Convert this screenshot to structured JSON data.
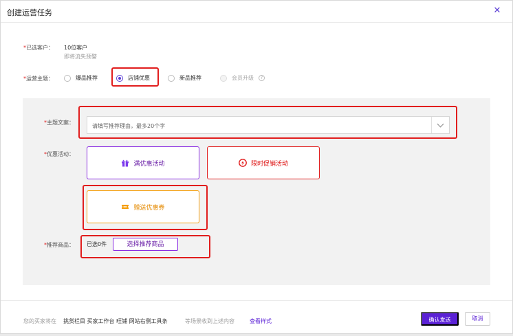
{
  "dialog": {
    "title": "创建运营任务",
    "close_glyph": "✕"
  },
  "customers": {
    "label": "已选客户：",
    "value": "10位客户",
    "subtext": "即将流失预警"
  },
  "theme": {
    "label": "运营主题：",
    "options": [
      {
        "label": "爆品推荐",
        "checked": false,
        "disabled": false
      },
      {
        "label": "店铺优惠",
        "checked": true,
        "disabled": false
      },
      {
        "label": "新品推荐",
        "checked": false,
        "disabled": false
      },
      {
        "label": "会员升级",
        "checked": false,
        "disabled": true
      }
    ],
    "help_glyph": "?"
  },
  "copy": {
    "label": "主题文案：",
    "placeholder": "请填写推荐理由，最多20个字"
  },
  "promo": {
    "label": "优惠活动：",
    "cards": [
      {
        "label": "满优惠活动",
        "icon": "gift-icon",
        "color": "#8a2be2"
      },
      {
        "label": "限时促销活动",
        "icon": "lightning-icon",
        "color": "#e11d1d"
      },
      {
        "label": "赠送优惠券",
        "icon": "coupon-icon",
        "color": "#f59e0b"
      }
    ]
  },
  "products": {
    "label": "推荐商品：",
    "selected_count": "已选0件",
    "select_button": "选择推荐商品"
  },
  "footer": {
    "prefix": "您的买家将在",
    "channels": "挑货栏目 买家工作台 旺铺 网站右侧工具条",
    "suffix": "等场景收到上述内容",
    "preview_link": "查看样式",
    "confirm_button": "确认发送",
    "cancel_button": "取消"
  },
  "colors": {
    "accent": "#5b21d6",
    "highlight": "#e11d1d"
  }
}
